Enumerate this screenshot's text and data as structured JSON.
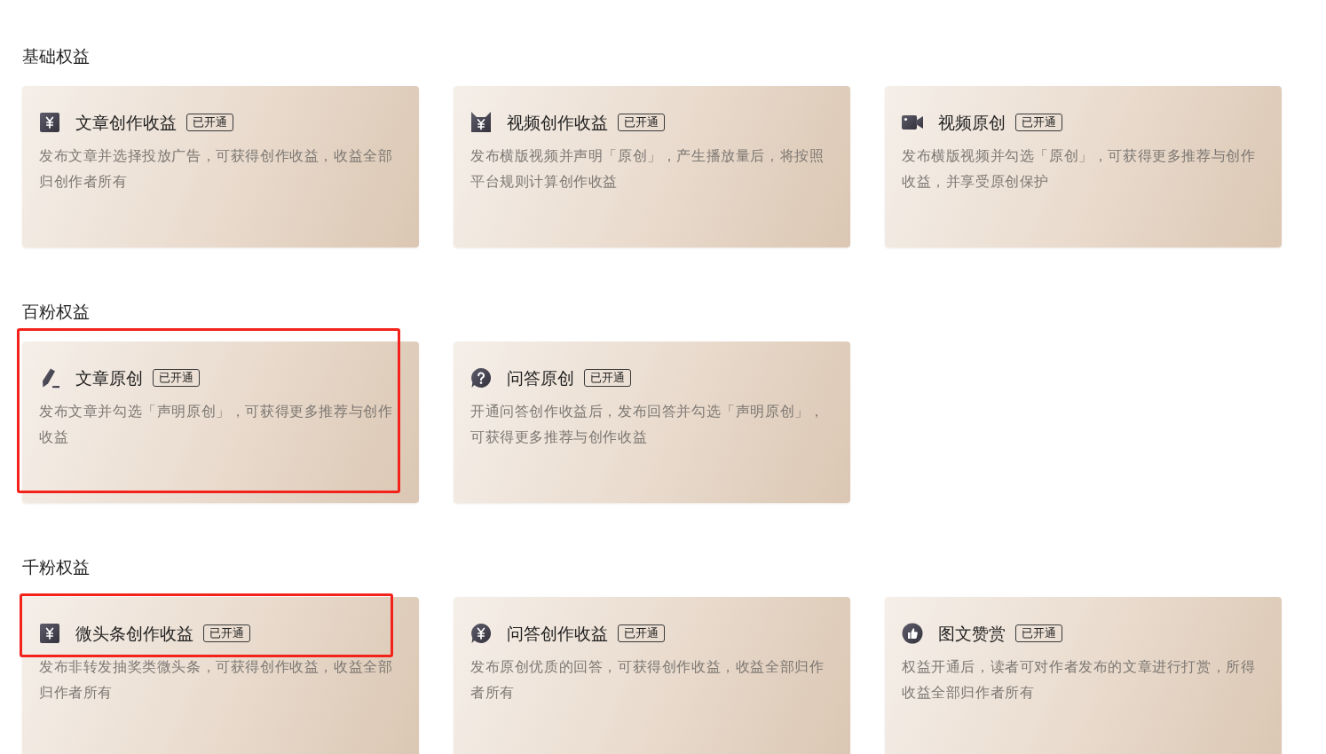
{
  "sections": [
    {
      "title": "基础权益",
      "cards": [
        {
          "kind": "yuan-square",
          "title": "文章创作收益",
          "badge": "已开通",
          "description": "发布文章并选择投放广告，可获得创作收益，收益全部归创作者所有",
          "highlighted": false,
          "header_highlighted": false
        },
        {
          "kind": "yuan-box",
          "title": "视频创作收益",
          "badge": "已开通",
          "description": "发布横版视频并声明「原创」，产生播放量后，将按照平台规则计算创作收益",
          "highlighted": false,
          "header_highlighted": false
        },
        {
          "kind": "camera",
          "title": "视频原创",
          "badge": "已开通",
          "description": "发布横版视频并勾选「原创」，可获得更多推荐与创作收益，并享受原创保护",
          "highlighted": false,
          "header_highlighted": false
        }
      ]
    },
    {
      "title": "百粉权益",
      "cards": [
        {
          "kind": "pencil",
          "title": "文章原创",
          "badge": "已开通",
          "description": "发布文章并勾选「声明原创」，可获得更多推荐与创作收益",
          "highlighted": true,
          "header_highlighted": false
        },
        {
          "kind": "question",
          "title": "问答原创",
          "badge": "已开通",
          "description": "开通问答创作收益后，发布回答并勾选「声明原创」，可获得更多推荐与创作收益",
          "highlighted": false,
          "header_highlighted": false
        }
      ]
    },
    {
      "title": "千粉权益",
      "cards": [
        {
          "kind": "yuan-square",
          "title": "微头条创作收益",
          "badge": "已开通",
          "description": "发布非转发抽奖类微头条，可获得创作收益，收益全部归作者所有",
          "highlighted": false,
          "header_highlighted": true
        },
        {
          "kind": "yuan-bubble",
          "title": "问答创作收益",
          "badge": "已开通",
          "description": "发布原创优质的回答，可获得创作收益，收益全部归作者所有",
          "highlighted": false,
          "header_highlighted": false
        },
        {
          "kind": "thumb",
          "title": "图文赞赏",
          "badge": "已开通",
          "description": "权益开通后，读者可对作者发布的文章进行打赏，所得收益全部归作者所有",
          "highlighted": false,
          "header_highlighted": false
        }
      ]
    }
  ]
}
